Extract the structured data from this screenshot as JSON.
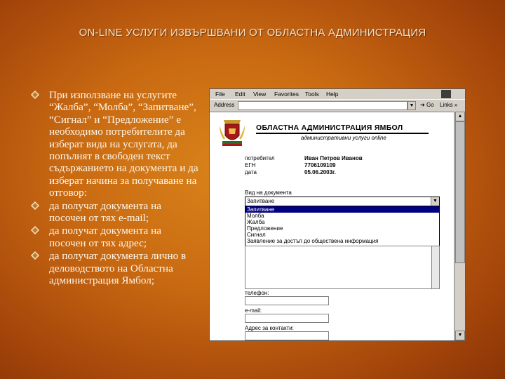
{
  "slide": {
    "title": "ON-LINE УСЛУГИ ИЗВЪРШВАНИ ОТ ОБЛАСТНА АДМИНИСТРАЦИЯ",
    "bullets": [
      "При използване на услугите “Жалба”, “Молба”, “Запитване”, “Сигнал” и “Предложение” е необходимо потребителите да изберат вида на услугата, да попълнят в свободен текст съдържанието на документа и да изберат начина за получаване на отговор:",
      "да получат документа на посочен от тях e-mail;",
      "да получат документа на посочен от тях адрес;",
      "да получат документа лично в деловодството на Областна администрация Ямбол;"
    ]
  },
  "browser": {
    "menu": [
      "File",
      "Edit",
      "View",
      "Favorites",
      "Tools",
      "Help"
    ],
    "address_label": "Address",
    "go_label": "Go",
    "links_label": "Links »"
  },
  "page": {
    "org_title": "ОБЛАСТНА АДМИНИСТРАЦИЯ ЯМБОЛ",
    "org_subtitle": "административни услуги online",
    "info": [
      {
        "label": "потребител",
        "value": "Иван Петров Иванов"
      },
      {
        "label": "ЕГН",
        "value": "7706109109"
      },
      {
        "label": "дата",
        "value": "05.06.2003г."
      }
    ],
    "doc_type_label": "Вид на документа",
    "doc_type_selected": "Запитване",
    "doc_type_options": [
      "Запитване",
      "Молба",
      "Жалба",
      "Предложение",
      "Сигнал",
      "Заявление за достъп до обществена информация"
    ],
    "phone_label": "телефон:",
    "email_label": "e-mail:",
    "address_label": "Адрес за контакти:"
  }
}
